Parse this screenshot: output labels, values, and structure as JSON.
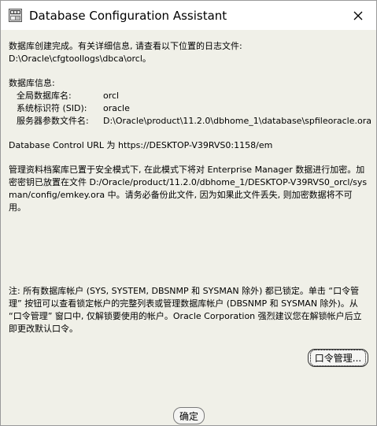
{
  "window": {
    "title": "Database Configuration Assistant",
    "close_icon": "close-icon",
    "app_icon": "database-config-app-icon"
  },
  "content": {
    "completion_line": "数据库创建完成。有关详细信息, 请查看以下位置的日志文件:",
    "log_path": " D:\\Oracle\\cfgtoollogs\\dbca\\orcl。",
    "db_info_heading": "数据库信息:",
    "db_info": [
      {
        "label": "全局数据库名:",
        "value": "orcl"
      },
      {
        "label": "系统标识符 (SID):",
        "value": "oracle"
      },
      {
        "label": "服务器参数文件名:",
        "value": "D:\\Oracle\\product\\11.2.0\\dbhome_1\\database\\spfileoracle.ora"
      }
    ],
    "control_url": "Database Control URL 为 https://DESKTOP-V39RVS0:1158/em",
    "repository_note": "管理资料档案库已置于安全模式下, 在此模式下将对 Enterprise Manager 数据进行加密。加密密钥已放置在文件 D:/Oracle/product/11.2.0/dbhome_1/DESKTOP-V39RVS0_orcl/sysman/config/emkey.ora 中。请务必备份此文件, 因为如果此文件丢失, 则加密数据将不可用。",
    "lock_note": "注: 所有数据库帐户 (SYS, SYSTEM, DBSNMP 和 SYSMAN 除外) 都已锁定。单击 “口令管理” 按钮可以查看锁定帐户的完整列表或管理数据库帐户 (DBSNMP 和 SYSMAN 除外)。从 “口令管理” 窗口中, 仅解锁要使用的帐户。Oracle Corporation 强烈建议您在解锁帐户后立即更改默认口令。"
  },
  "buttons": {
    "password_management": "口令管理...",
    "ok": "确定"
  }
}
